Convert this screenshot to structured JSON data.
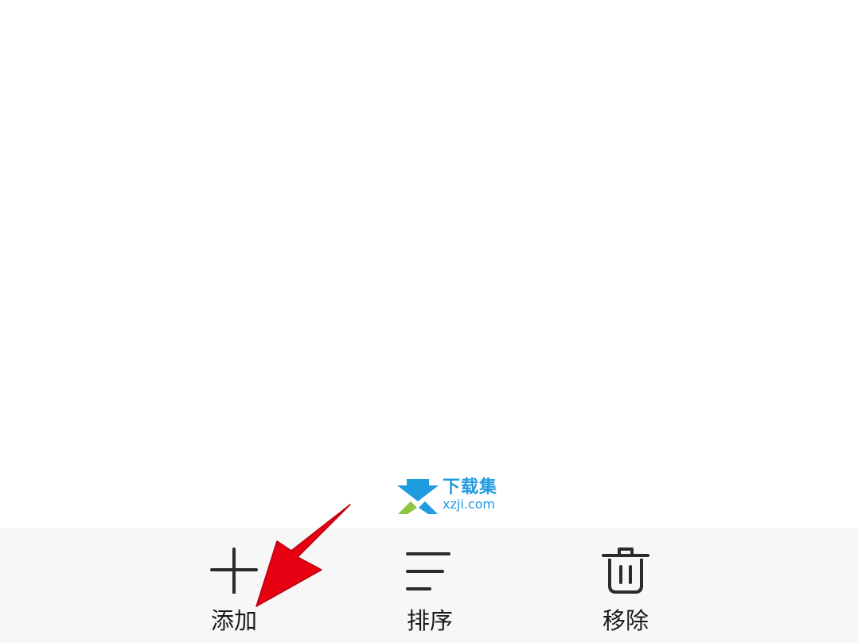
{
  "watermark": {
    "title": "下载集",
    "url": "xzji.com"
  },
  "toolbar": {
    "items": [
      {
        "label": "添加",
        "icon": "plus-icon"
      },
      {
        "label": "排序",
        "icon": "sort-lines-icon"
      },
      {
        "label": "移除",
        "icon": "trash-icon"
      }
    ]
  },
  "colors": {
    "toolbar_background": "#f7f7f7",
    "icon_color": "#2b2b2b",
    "annotation_arrow": "#e60012",
    "watermark_blue": "#1f9be0",
    "watermark_green": "#8cc63f"
  }
}
